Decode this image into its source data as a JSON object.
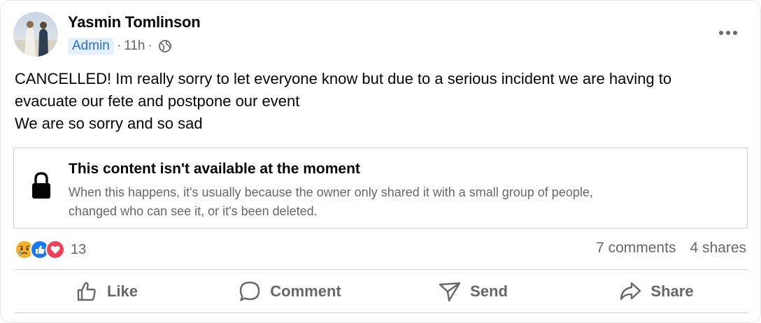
{
  "post": {
    "author": "Yasmin Tomlinson",
    "role_badge": "Admin",
    "time": "11h",
    "separator": "·",
    "text_lines": [
      "CANCELLED! Im really sorry to let everyone know but due to a serious incident we are having to",
      "evacuate our fete and postpone our event",
      "We are so sorry and so sad"
    ]
  },
  "unavailable": {
    "title": "This content isn't available at the moment",
    "description_lines": [
      "When this happens, it's usually because the owner only shared it with a small group of people,",
      "changed who can see it, or it's been deleted."
    ]
  },
  "engagement": {
    "reaction_count": "13",
    "comments": "7 comments",
    "shares": "4 shares",
    "reaction_types": [
      "sad",
      "like",
      "love"
    ]
  },
  "actions": {
    "like": "Like",
    "comment": "Comment",
    "send": "Send",
    "share": "Share"
  },
  "colors": {
    "badge_blue": "#216fdb",
    "secondary_text": "#65676b",
    "like_blue": "#1877f2",
    "love_red": "#f33e58",
    "sad_yellow": "#f7b125"
  }
}
